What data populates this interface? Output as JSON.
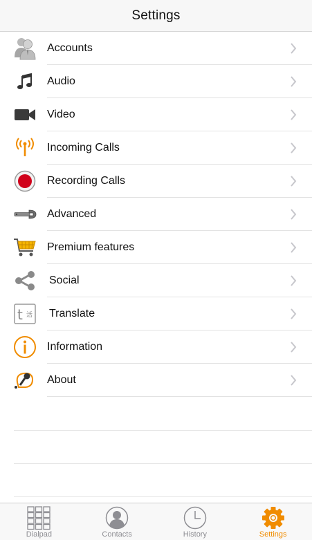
{
  "header": {
    "title": "Settings"
  },
  "colors": {
    "accent": "#f08c00",
    "tab_inactive": "#8e8e93",
    "record_red": "#d0021b"
  },
  "settings": {
    "items": [
      {
        "label": "Accounts",
        "icon": "accounts-icon"
      },
      {
        "label": "Audio",
        "icon": "music-note-icon"
      },
      {
        "label": "Video",
        "icon": "video-camera-icon"
      },
      {
        "label": "Incoming Calls",
        "icon": "antenna-icon"
      },
      {
        "label": "Recording Calls",
        "icon": "record-icon"
      },
      {
        "label": "Advanced",
        "icon": "wrench-icon"
      },
      {
        "label": "Premium features",
        "icon": "shopping-cart-icon"
      },
      {
        "label": "Social",
        "icon": "share-icon"
      },
      {
        "label": "Translate",
        "icon": "translate-icon"
      },
      {
        "label": "Information",
        "icon": "info-icon"
      },
      {
        "label": "About",
        "icon": "about-icon"
      }
    ]
  },
  "tabbar": {
    "tabs": [
      {
        "label": "Dialpad",
        "icon": "dialpad-icon",
        "active": false
      },
      {
        "label": "Contacts",
        "icon": "contacts-icon",
        "active": false
      },
      {
        "label": "History",
        "icon": "clock-icon",
        "active": false
      },
      {
        "label": "Settings",
        "icon": "gear-icon",
        "active": true
      }
    ]
  }
}
